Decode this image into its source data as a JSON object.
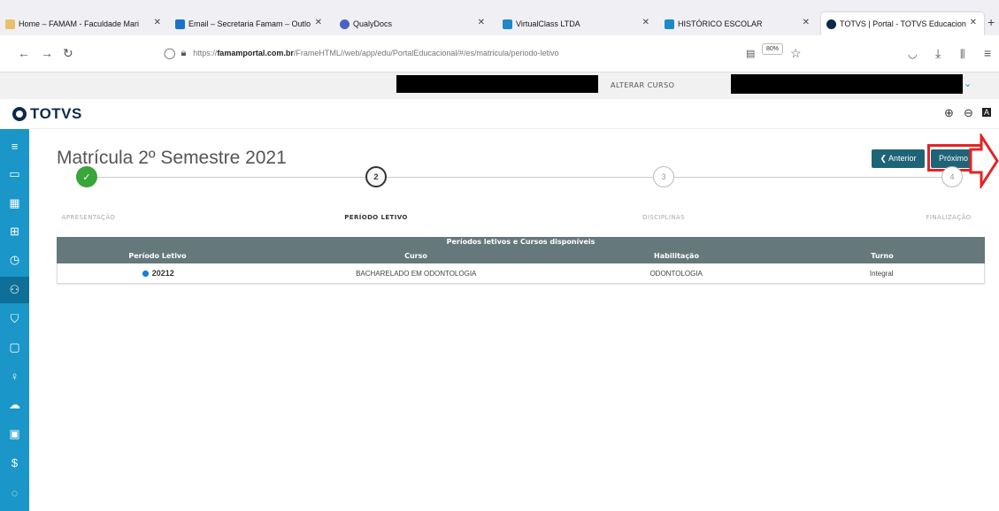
{
  "browser": {
    "tabs": [
      {
        "label": "Home – FAMAM - Faculdade Mari",
        "color": "#e8c26b",
        "active": false
      },
      {
        "label": "Email – Secretaria Famam – Outlo",
        "color": "#1a73c8",
        "active": false
      },
      {
        "label": "QualyDocs",
        "color": "#4a63c8",
        "active": false
      },
      {
        "label": "VirtualClass LTDA",
        "color": "#1e88c8",
        "active": false
      },
      {
        "label": "HISTÓRICO ESCOLAR",
        "color": "#1e88c8",
        "active": false
      },
      {
        "label": "TOTVS | Portal - TOTVS Educacion",
        "color": "#0c2a4a",
        "active": true
      }
    ],
    "url_prefix": "https://",
    "url_host": "famamportal.com.br",
    "url_path": "/FrameHTML//web/app/edu/PortalEducacional/#/es/matricula/periodo-letivo",
    "zoom": "80%"
  },
  "header": {
    "change_course_label": "ALTERAR CURSO",
    "brand": "TOTVS"
  },
  "page": {
    "title": "Matrícula 2º Semestre 2021",
    "prev_label": "❮ Anterior",
    "next_label": "Próximo ❯"
  },
  "steps": [
    {
      "number": "✓",
      "label": "APRESENTAÇÃO",
      "state": "done"
    },
    {
      "number": "2",
      "label": "PERÍODO LETIVO",
      "state": "current"
    },
    {
      "number": "3",
      "label": "DISCIPLINAS",
      "state": "pending"
    },
    {
      "number": "4",
      "label": "FINALIZAÇÃO",
      "state": "pending"
    }
  ],
  "table": {
    "caption": "Períodos letivos e Cursos disponíveis",
    "headers": [
      "Período Letivo",
      "Curso",
      "Habilitação",
      "Turno"
    ],
    "rows": [
      {
        "periodo": "20212",
        "curso": "BACHARELADO EM ODONTOLOGIA",
        "habilitacao": "ODONTOLOGIA",
        "turno": "Integral",
        "selected": true
      }
    ]
  },
  "sidebar": {
    "items": [
      "menu-icon",
      "monitor-icon",
      "calendar-icon",
      "grid-icon",
      "clock-icon",
      "user-add-icon",
      "graduation-icon",
      "clipboard-icon",
      "lightbulb-icon",
      "cloud-icon",
      "document-icon",
      "dollar-icon",
      "chat-icon"
    ],
    "accent": "#1a96c8"
  }
}
